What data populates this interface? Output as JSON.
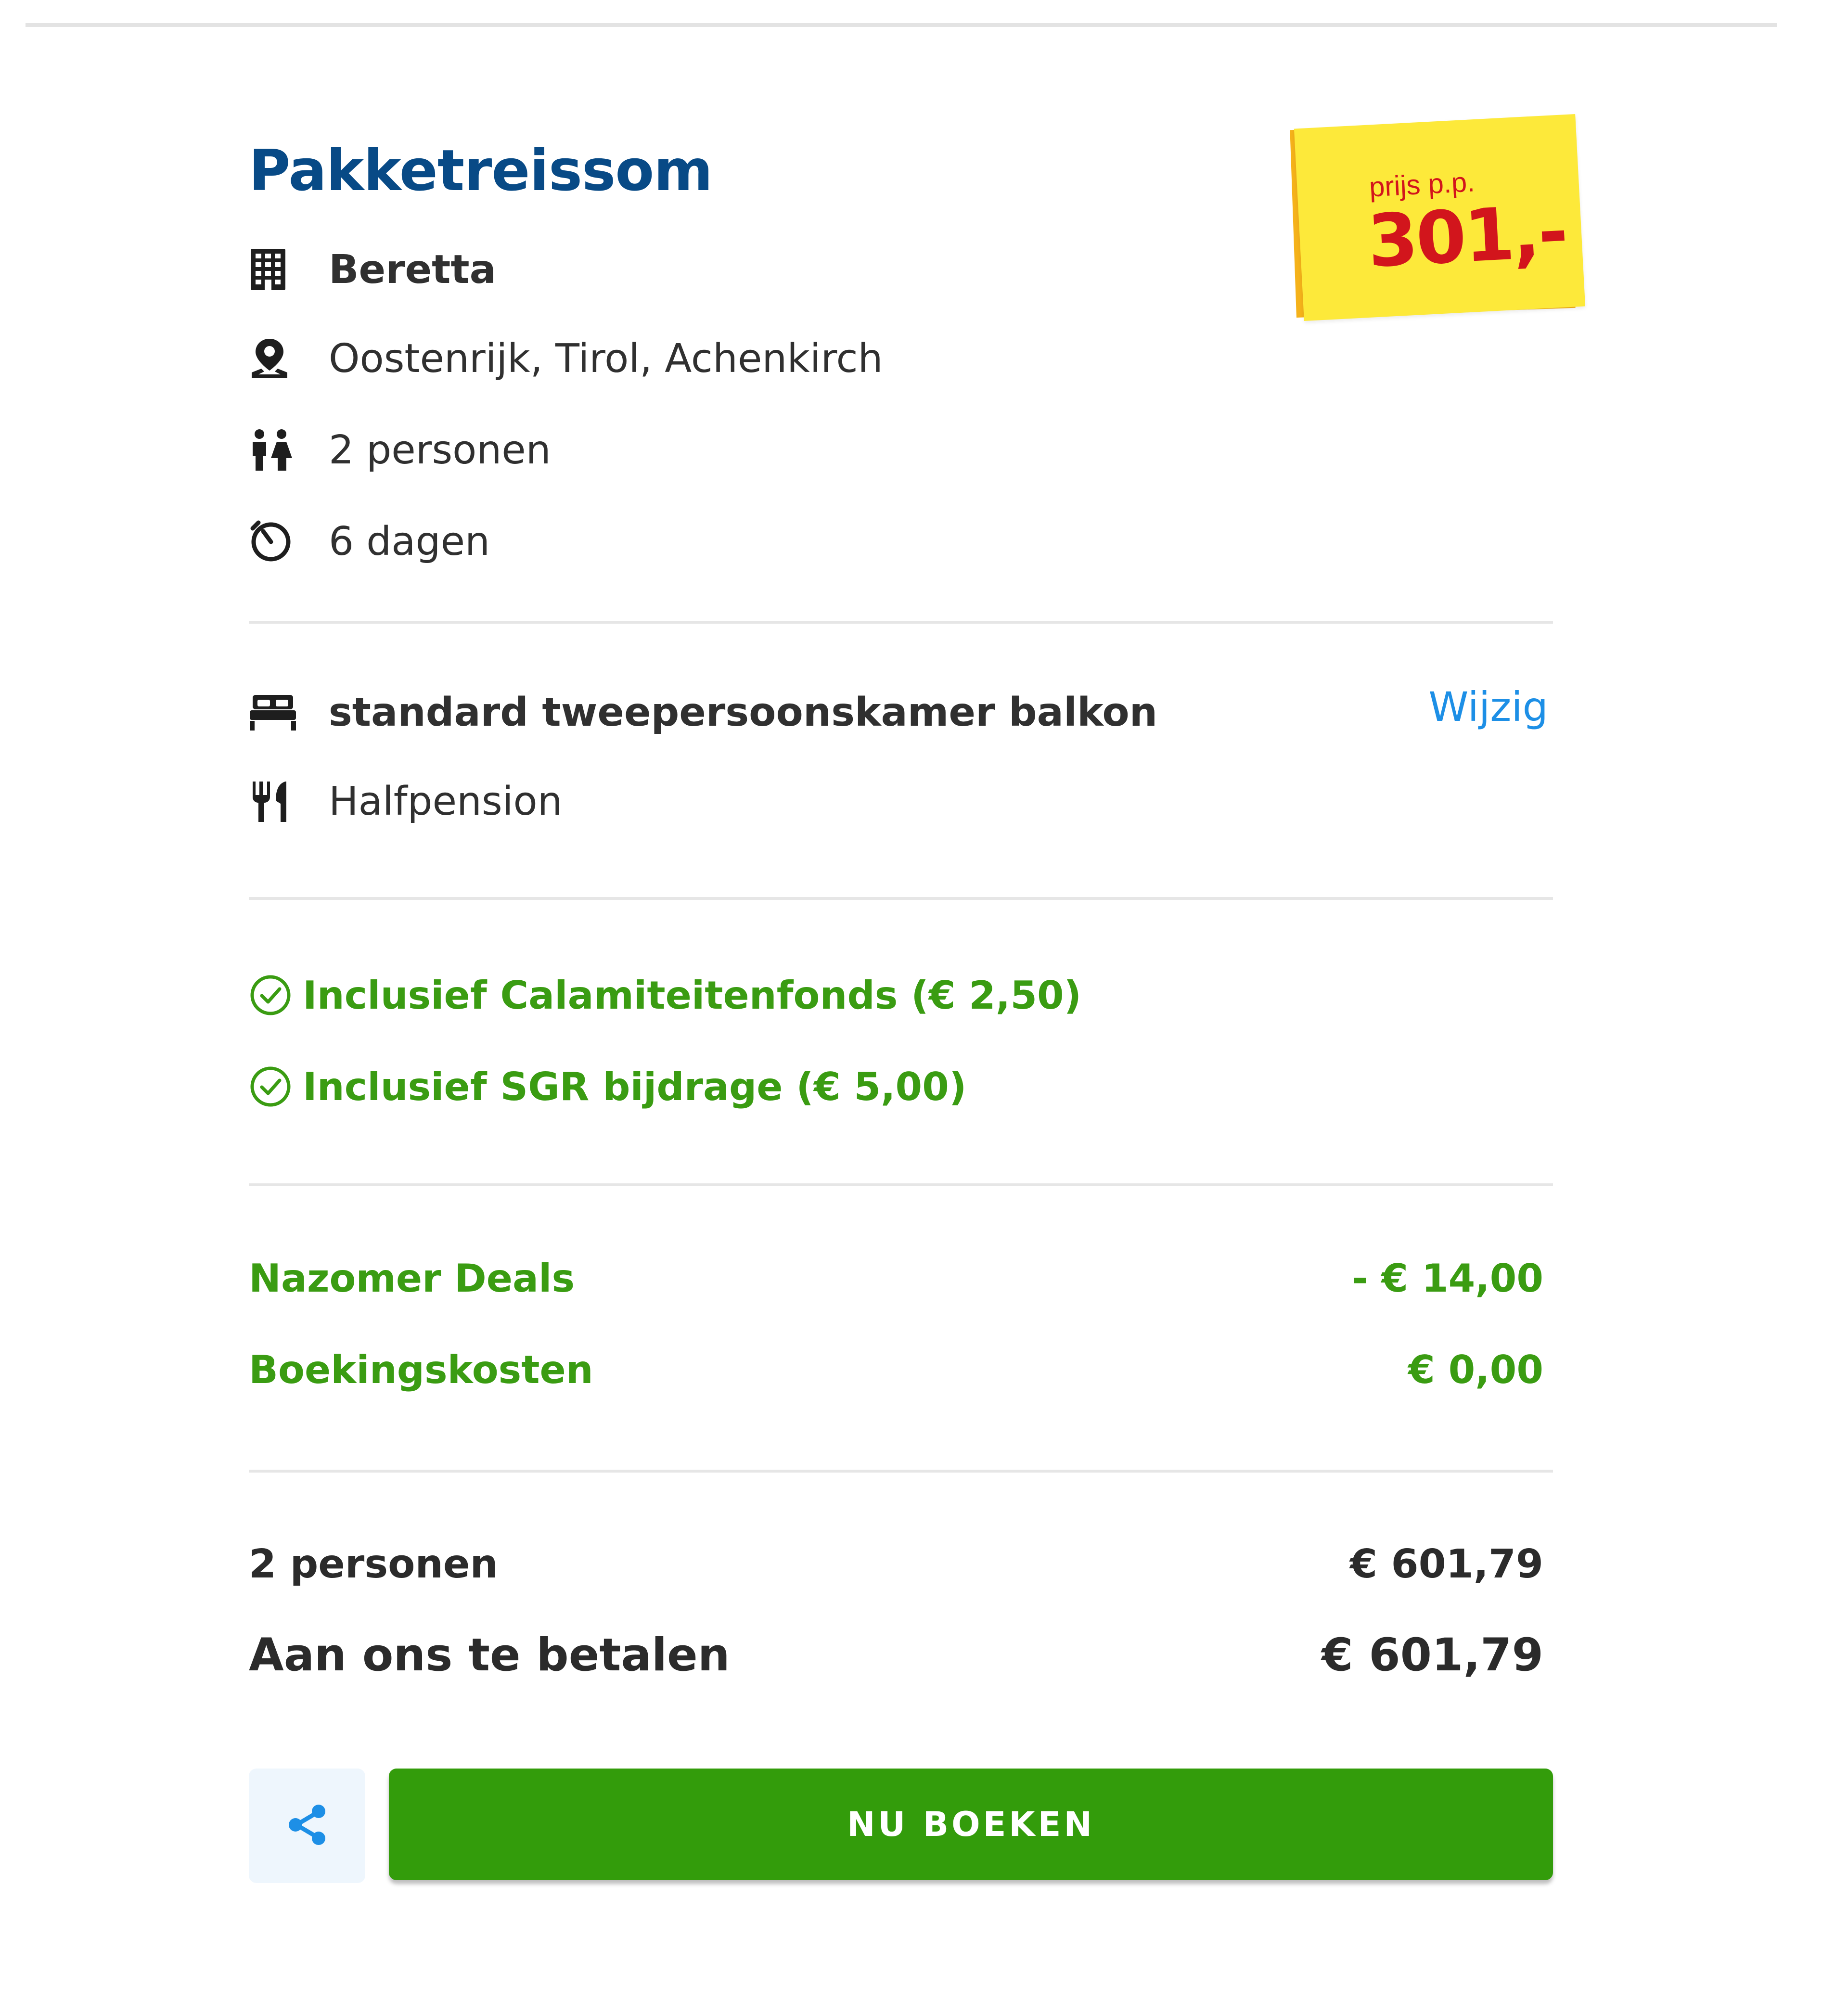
{
  "summary": {
    "title": "Pakketreissom",
    "hotel": "Beretta",
    "location": "Oostenrijk, Tirol, Achenkirch",
    "persons": "2 personen",
    "duration": "6 dagen"
  },
  "price_sticker": {
    "label": "prijs p.p.",
    "amount": "301,-"
  },
  "room": {
    "name": "standard tweepersoonskamer balkon",
    "change_label": "Wijzig",
    "board": "Halfpension"
  },
  "included": [
    {
      "label": "Inclusief Calamiteitenfonds (€ 2,50)"
    },
    {
      "label": "Inclusief SGR bijdrage (€ 5,00)"
    }
  ],
  "adjustments": [
    {
      "label": "Nazomer Deals",
      "amount": "- € 14,00"
    },
    {
      "label": "Boekingskosten",
      "amount": "€ 0,00"
    }
  ],
  "totals": {
    "persons_label": "2 personen",
    "persons_amount": "€ 601,79",
    "pay_label": "Aan ons te betalen",
    "pay_amount": "€ 601,79"
  },
  "actions": {
    "book_label": "NU BOEKEN",
    "share_icon": "share-icon"
  },
  "colors": {
    "title": "#084a86",
    "green": "#3a9c12",
    "link": "#1d8fe6",
    "button": "#339c0b",
    "sticker_yellow": "#fde93a",
    "sticker_orange": "#f5b21a",
    "sticker_red": "#d2151c"
  }
}
